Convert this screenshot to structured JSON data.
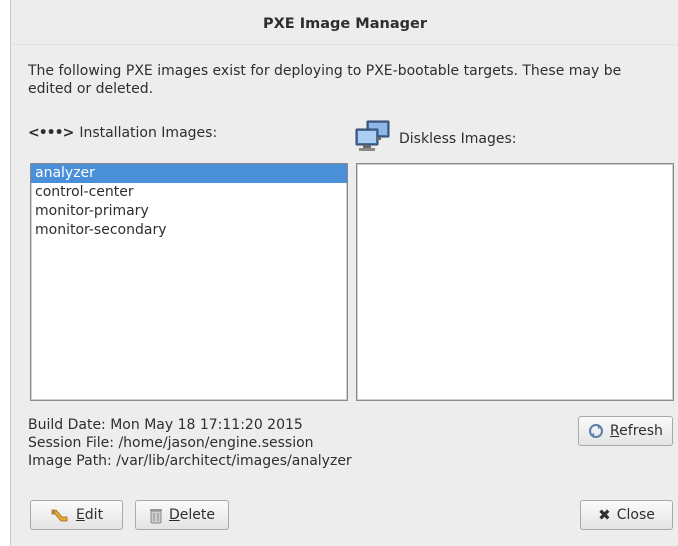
{
  "window": {
    "title": "PXE Image Manager"
  },
  "description": "The following PXE images exist for deploying to PXE-bootable targets.  These may be edited or deleted.",
  "installation": {
    "label": "Installation Images:",
    "icon": "network-arrows-icon",
    "items": [
      {
        "label": "analyzer",
        "selected": true
      },
      {
        "label": "control-center",
        "selected": false
      },
      {
        "label": "monitor-primary",
        "selected": false
      },
      {
        "label": "monitor-secondary",
        "selected": false
      }
    ]
  },
  "diskless": {
    "label": "Diskless Images:",
    "icon": "computer-monitor-icon",
    "items": []
  },
  "info": {
    "build_date": "Build Date:  Mon May 18 17:11:20 2015",
    "session_file": "Session File:  /home/jason/engine.session",
    "image_path": "Image Path:  /var/lib/architect/images/analyzer"
  },
  "buttons": {
    "refresh_mnemonic": "R",
    "refresh_rest": "efresh",
    "edit_mnemonic": "E",
    "edit_rest": "dit",
    "delete_mnemonic": "D",
    "delete_rest": "elete",
    "close": "Close"
  },
  "colors": {
    "selection": "#4a90d9",
    "window_bg": "#ededed"
  }
}
